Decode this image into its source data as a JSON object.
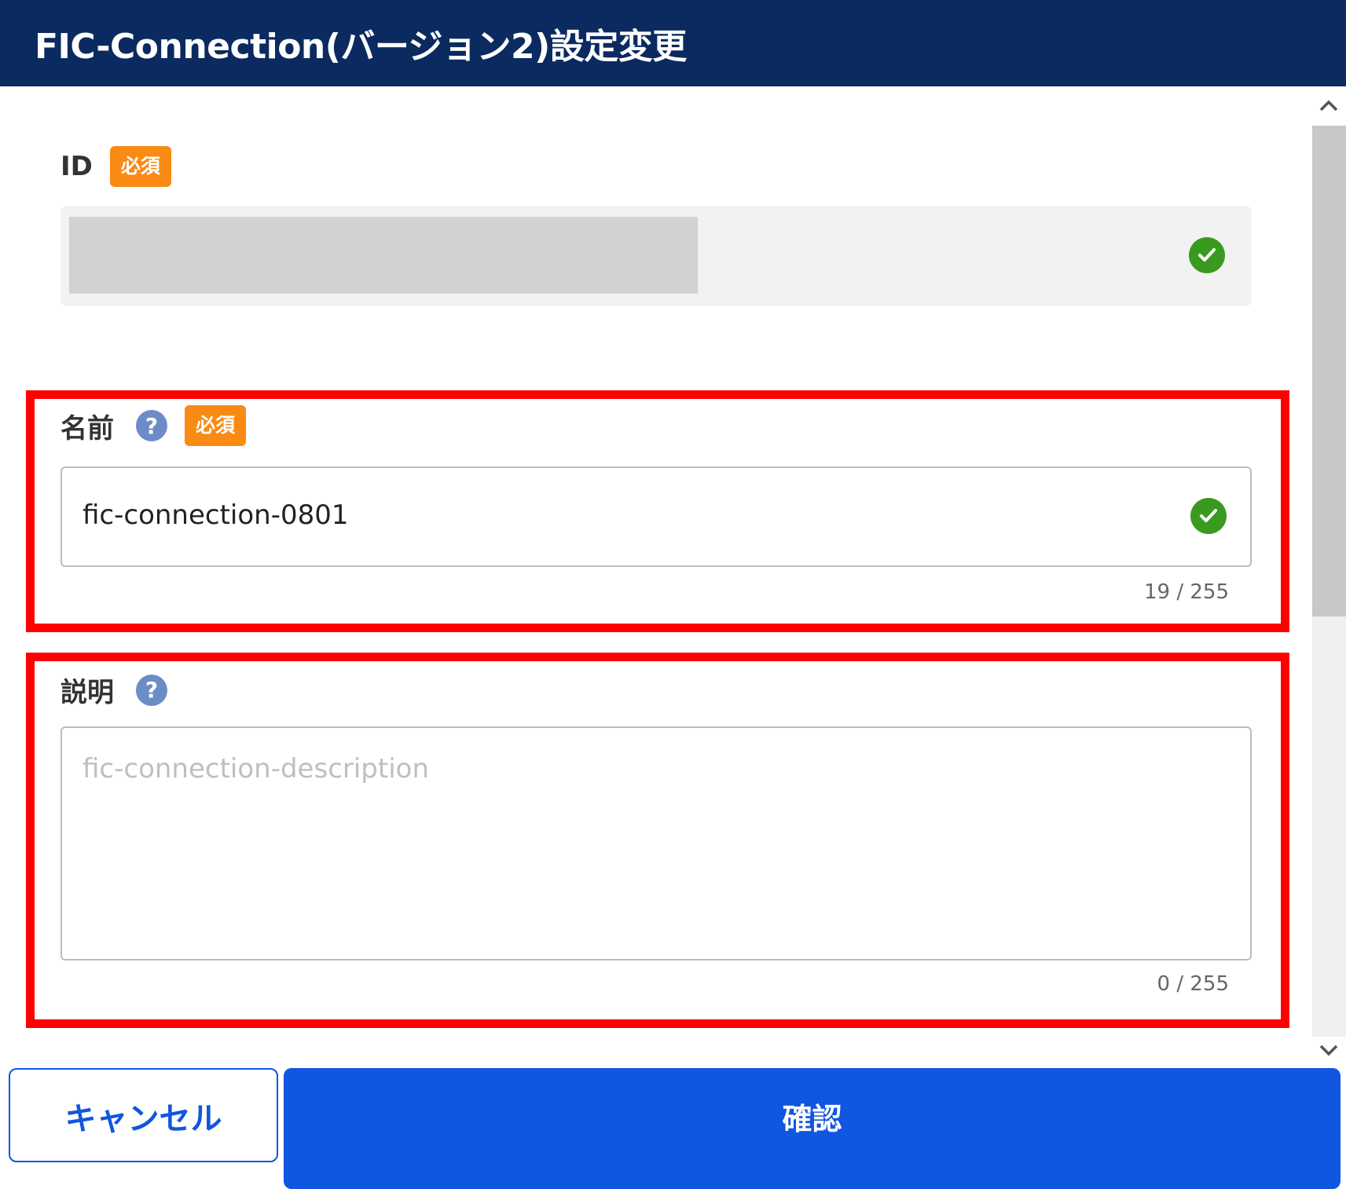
{
  "dialog": {
    "title": "FIC-Connection(バージョン2)設定変更"
  },
  "id_field": {
    "label": "ID",
    "required_badge": "必須",
    "value": ""
  },
  "name_field": {
    "label": "名前",
    "help_icon": "?",
    "required_badge": "必須",
    "value": "fic-connection-0801",
    "counter": "19 / 255"
  },
  "description_field": {
    "label": "説明",
    "help_icon": "?",
    "placeholder": "fic-connection-description",
    "counter": "0 / 255"
  },
  "buttons": {
    "cancel": "キャンセル",
    "confirm": "確認"
  },
  "colors": {
    "header": "#0b2a5f",
    "required_badge": "#f98a14",
    "valid_check": "#3a9a1f",
    "highlight_border": "#ff0000",
    "primary": "#1056e0"
  },
  "icons": [
    "check-circle-icon",
    "help-icon",
    "scroll-up-icon",
    "scroll-down-icon"
  ]
}
